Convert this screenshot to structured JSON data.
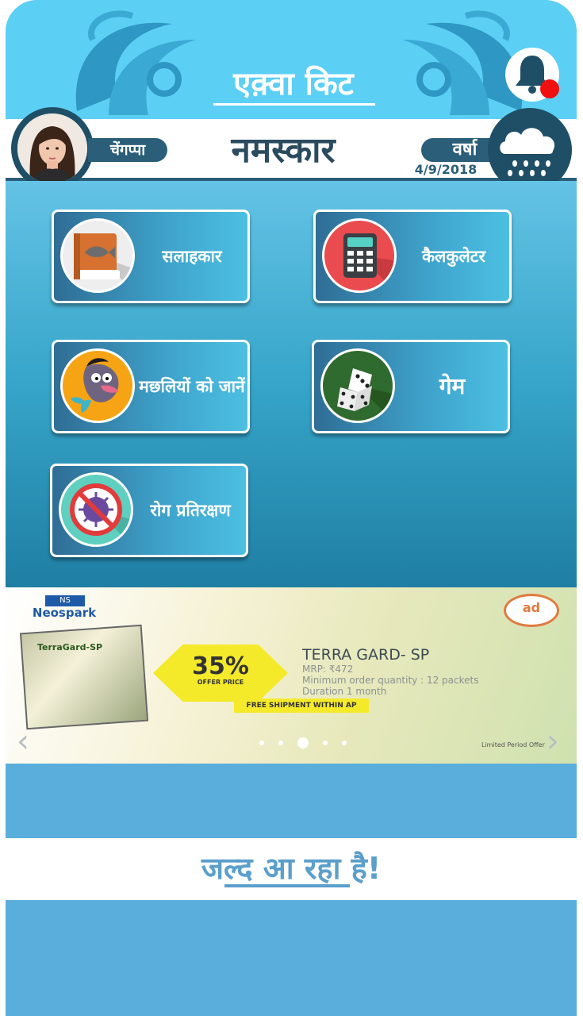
{
  "header": {
    "app_title": "एक़्वा किट",
    "notification_icon": "bell-icon",
    "notification_dot_color": "#f01010"
  },
  "greeting_bar": {
    "user_name": "चेंगप्पा",
    "greeting": "नमस्कार",
    "weather_label": "वर्षा",
    "date": "4/9/2018",
    "weather_icon": "rain-cloud-icon"
  },
  "menu": {
    "items": [
      {
        "label": "सलाहकार",
        "icon": "fish-book-icon"
      },
      {
        "label": "कैलकुलेटर",
        "icon": "calculator-icon"
      },
      {
        "label": "मछलियों को जानें",
        "icon": "fish-character-icon"
      },
      {
        "label": "गेम",
        "icon": "dice-icon"
      },
      {
        "label": "रोग प्रतिरक्षण",
        "icon": "no-virus-icon"
      }
    ]
  },
  "ad_banner": {
    "brand": "Neospark",
    "brand_logo": "NS",
    "badge": "ad",
    "offer_percent": "35%",
    "offer_sub": "OFFER PRICE",
    "shipping": "FREE SHIPMENT WITHIN AP",
    "product_title": "TERRA GARD- SP",
    "mrp": "MRP: ₹472",
    "min_order": "Minimum order quantity : 12 packets",
    "duration": "Duration 1 month",
    "limited": "Limited Period Offer",
    "packet_label": "TerraGard-SP",
    "slide_count": 5,
    "active_slide": 3,
    "prev_icon": "chevron-left-icon",
    "next_icon": "chevron-right-icon"
  },
  "coming_soon": {
    "text": "जल्द आ रहा है!"
  }
}
